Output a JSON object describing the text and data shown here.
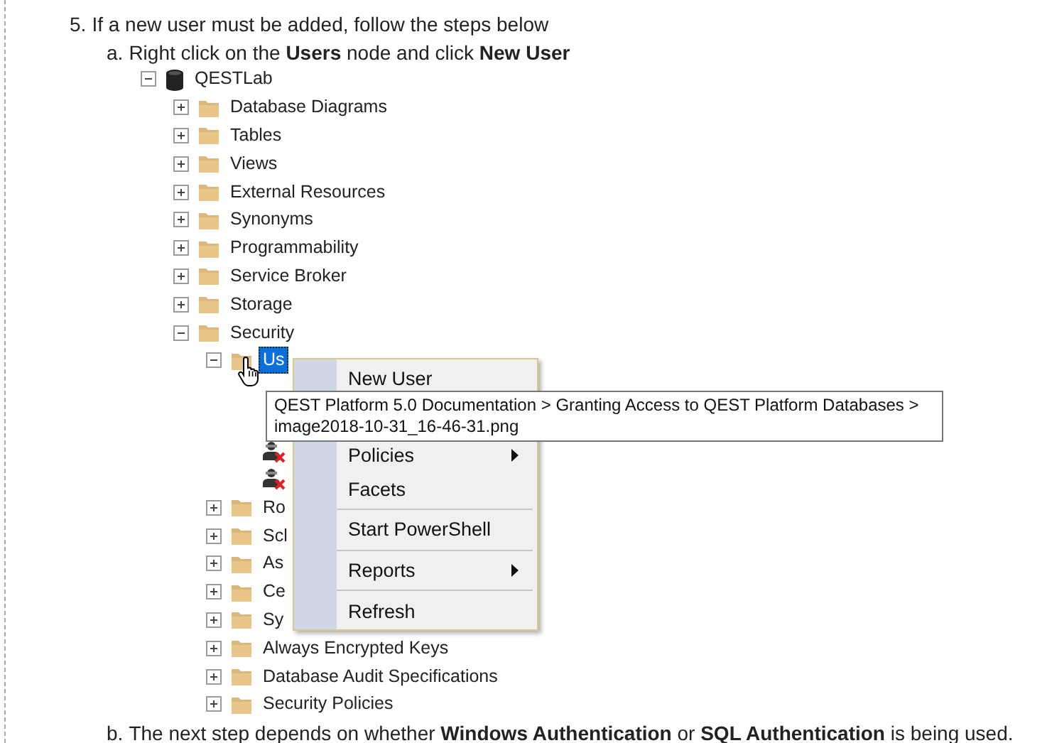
{
  "step": {
    "number": "5.",
    "text": "If a new user must be added, follow the steps below"
  },
  "substep_a": {
    "number": "a.",
    "text": "Right click on the **Users** node and click **New User**"
  },
  "tree": {
    "label": "QESTLab",
    "kind": "database",
    "expanded": true,
    "children": [
      {
        "label": "Database Diagrams",
        "kind": "folder",
        "expanded": false
      },
      {
        "label": "Tables",
        "kind": "folder",
        "expanded": false
      },
      {
        "label": "Views",
        "kind": "folder",
        "expanded": false
      },
      {
        "label": "External Resources",
        "kind": "folder",
        "expanded": false
      },
      {
        "label": "Synonyms",
        "kind": "folder",
        "expanded": false
      },
      {
        "label": "Programmability",
        "kind": "folder",
        "expanded": false
      },
      {
        "label": "Service Broker",
        "kind": "folder",
        "expanded": false
      },
      {
        "label": "Storage",
        "kind": "folder",
        "expanded": false
      },
      {
        "label": "Security",
        "kind": "folder",
        "expanded": true,
        "children": [
          {
            "label": "Us",
            "kind": "folder",
            "expanded": true,
            "selected": true,
            "children": [
              {
                "kind": "user-disabled"
              },
              {
                "kind": "user-disabled"
              }
            ]
          },
          {
            "label": "Ro",
            "kind": "folder",
            "expanded": false,
            "selected": false
          },
          {
            "label": "Scl",
            "kind": "folder",
            "expanded": false,
            "selected": false
          },
          {
            "label": "As",
            "kind": "folder",
            "expanded": false,
            "selected": false
          },
          {
            "label": "Ce",
            "kind": "folder",
            "expanded": false,
            "selected": false
          },
          {
            "label": "Sy",
            "kind": "folder",
            "expanded": false,
            "selected": false
          },
          {
            "label": "Always Encrypted Keys",
            "kind": "folder",
            "expanded": false,
            "selected": false
          },
          {
            "label": "Database Audit Specifications",
            "kind": "folder",
            "expanded": false,
            "selected": false
          },
          {
            "label": "Security Policies",
            "kind": "folder",
            "expanded": false,
            "selected": false
          }
        ]
      }
    ]
  },
  "context_menu": [
    {
      "kind": "item",
      "label": "New User",
      "submenu": false
    },
    {
      "kind": "item",
      "label": "Policies",
      "submenu": true
    },
    {
      "kind": "item",
      "label": "Facets",
      "submenu": false
    },
    {
      "kind": "separator"
    },
    {
      "kind": "item",
      "label": "Start PowerShell",
      "submenu": false
    },
    {
      "kind": "separator"
    },
    {
      "kind": "item",
      "label": "Reports",
      "submenu": true
    },
    {
      "kind": "separator"
    },
    {
      "kind": "item",
      "label": "Refresh",
      "submenu": false
    }
  ],
  "tooltip": {
    "text": "QEST Platform 5.0 Documentation > Granting Access to QEST Platform Databases > image2018-10-31_16-46-31.png"
  },
  "substep_b": {
    "number": "b.",
    "text": "The next step depends on whether **Windows Authentication** or **SQL Authentication** is being used."
  }
}
